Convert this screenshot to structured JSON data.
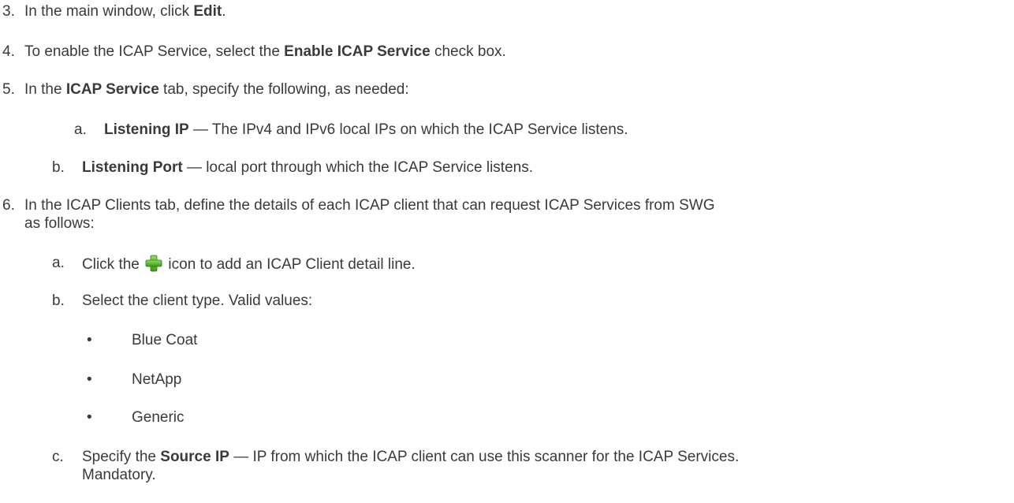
{
  "steps": [
    {
      "num": "3.",
      "parts": [
        {
          "t": "In the main window, click ",
          "b": false
        },
        {
          "t": "Edit",
          "b": true
        },
        {
          "t": ".",
          "b": false
        }
      ]
    },
    {
      "num": "4.",
      "parts": [
        {
          "t": "To enable the ICAP Service, select the ",
          "b": false
        },
        {
          "t": "Enable ICAP Service",
          "b": true
        },
        {
          "t": " check box.",
          "b": false
        }
      ]
    },
    {
      "num": "5.",
      "parts": [
        {
          "t": "In the ",
          "b": false
        },
        {
          "t": "ICAP Service",
          "b": true
        },
        {
          "t": " tab, specify the following, as needed:",
          "b": false
        }
      ]
    },
    {
      "num": "a.",
      "parts": [
        {
          "t": "Listening IP",
          "b": true
        },
        {
          "t": " — The IPv4 and IPv6 local IPs on which the ICAP Service listens.",
          "b": false
        }
      ]
    },
    {
      "num": "b.",
      "parts": [
        {
          "t": "Listening Port",
          "b": true
        },
        {
          "t": " — local port through which the ICAP Service listens.",
          "b": false
        }
      ]
    },
    {
      "num": "6.",
      "line1": "In the ICAP Clients tab, define the details of each ICAP client that can request ICAP Services from SWG",
      "line2": "as follows:"
    },
    {
      "num": "a.",
      "before_icon": "Click the ",
      "icon": "plus-icon",
      "after_icon": " icon to add an ICAP Client detail line."
    },
    {
      "num": "b.",
      "text": "Select the client type. Valid values:"
    },
    {
      "num": "c.",
      "line1_parts": [
        {
          "t": "Specify the ",
          "b": false
        },
        {
          "t": "Source IP",
          "b": true
        },
        {
          "t": " — IP from which the ICAP client can use this scanner for the ICAP Services.",
          "b": false
        }
      ],
      "line2": "Mandatory."
    }
  ],
  "bullets": [
    "Blue Coat",
    "NetApp",
    "Generic"
  ],
  "bullet_char": "•",
  "colors": {
    "text": "#3a3a3a",
    "icon_green": "#5cb82e"
  }
}
